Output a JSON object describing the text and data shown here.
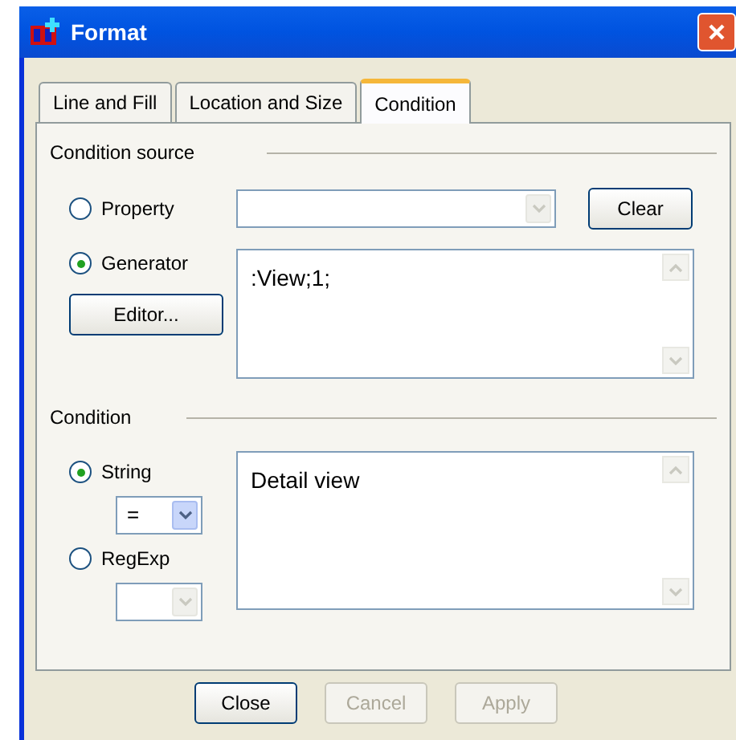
{
  "window": {
    "title": "Format"
  },
  "tabs": [
    {
      "label": "Line and Fill",
      "selected": false
    },
    {
      "label": "Location and Size",
      "selected": false
    },
    {
      "label": "Condition",
      "selected": true
    }
  ],
  "condition_source": {
    "title": "Condition source",
    "options": [
      {
        "label": "Property",
        "selected": false
      },
      {
        "label": "Generator",
        "selected": true
      }
    ],
    "property_combo": {
      "disabled": true
    },
    "clear_button": "Clear",
    "editor_button": "Editor...",
    "generator_text": ":View;1;"
  },
  "condition": {
    "title": "Condition",
    "options": [
      {
        "label": "String",
        "selected": true,
        "operator": "=",
        "operator_disabled": false
      },
      {
        "label": "RegExp",
        "selected": false,
        "operator_disabled": true
      }
    ],
    "text": "Detail view"
  },
  "buttons": [
    {
      "label": "Close",
      "disabled": false
    },
    {
      "label": "Cancel",
      "disabled": true
    },
    {
      "label": "Apply",
      "disabled": true
    }
  ]
}
